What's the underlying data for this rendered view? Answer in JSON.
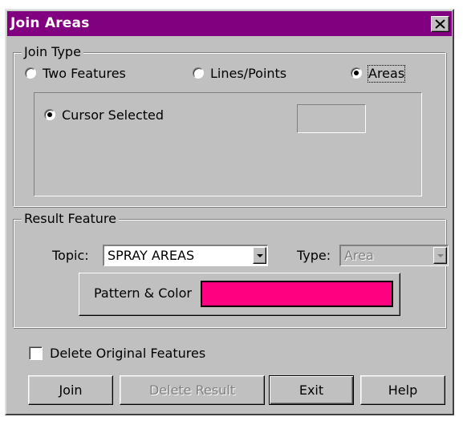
{
  "window": {
    "title": "Join Areas",
    "title_bar_color": "#800080",
    "close_icon": "close-icon"
  },
  "join_type": {
    "legend": "Join Type",
    "options": [
      {
        "label": "Two Features",
        "checked": false
      },
      {
        "label": "Lines/Points",
        "checked": false
      },
      {
        "label": "Areas",
        "checked": true
      }
    ],
    "selection_mode": {
      "label": "Cursor Selected",
      "checked": true,
      "value": ""
    }
  },
  "result_feature": {
    "legend": "Result Feature",
    "topic_label": "Topic:",
    "topic_value": "SPRAY AREAS",
    "type_label": "Type:",
    "type_value": "Area",
    "type_enabled": false,
    "pattern_label": "Pattern & Color",
    "pattern_color": "#ff0080"
  },
  "delete_original": {
    "label": "Delete Original Features",
    "checked": false
  },
  "buttons": {
    "join": "Join",
    "delete_result": "Delete Result",
    "exit": "Exit",
    "help": "Help"
  }
}
